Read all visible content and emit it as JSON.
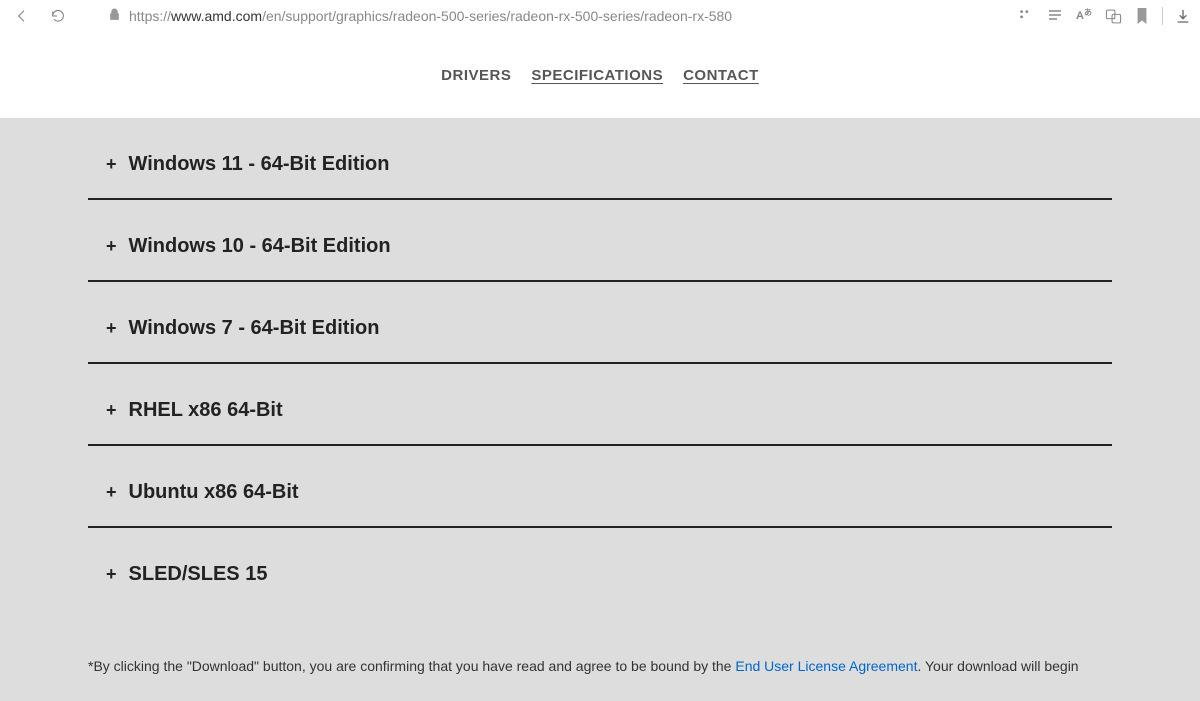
{
  "url": {
    "prefix": "https://",
    "domain": "www.amd.com",
    "path": "/en/support/graphics/radeon-500-series/radeon-rx-500-series/radeon-rx-580"
  },
  "tabs": {
    "drivers": "DRIVERS",
    "specifications": "SPECIFICATIONS",
    "contact": "CONTACT"
  },
  "accordion": [
    {
      "label": "Windows 11 - 64-Bit Edition"
    },
    {
      "label": "Windows 10 - 64-Bit Edition"
    },
    {
      "label": "Windows 7 - 64-Bit Edition"
    },
    {
      "label": "RHEL x86 64-Bit"
    },
    {
      "label": "Ubuntu x86 64-Bit"
    },
    {
      "label": "SLED/SLES 15"
    }
  ],
  "disclaimer": {
    "prefix": "*By clicking the \"Download\" button, you are confirming that you have read and agree to be bound by the ",
    "link": "End User License Agreement",
    "suffix": ". Your download will begin"
  },
  "plus": "+"
}
